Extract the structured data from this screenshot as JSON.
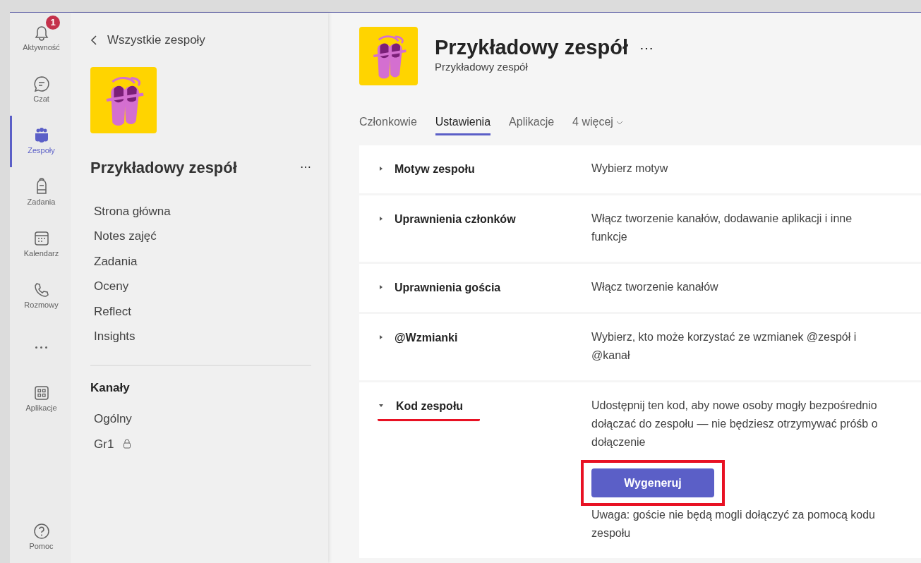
{
  "rail": [
    {
      "kind": "bell",
      "label": "Aktywność",
      "badge": "1",
      "selected": false
    },
    {
      "kind": "chat",
      "label": "Czat",
      "selected": false
    },
    {
      "kind": "teams",
      "label": "Zespoły",
      "selected": true
    },
    {
      "kind": "backpack",
      "label": "Zadania",
      "selected": false
    },
    {
      "kind": "calendar",
      "label": "Kalendarz",
      "selected": false
    },
    {
      "kind": "phone",
      "label": "Rozmowy",
      "selected": false
    },
    {
      "kind": "more",
      "selected": false
    },
    {
      "kind": "apps",
      "label": "Aplikacje",
      "selected": false
    }
  ],
  "rail_bottom": {
    "kind": "help",
    "label": "Pomoc"
  },
  "team_panel": {
    "back": "Wszystkie zespoły",
    "team_name": "Przykładowy zespół",
    "more": "⋯",
    "nav": [
      "Strona główna",
      "Notes zajęć",
      "Zadania",
      "Oceny",
      "Reflect",
      "Insights"
    ],
    "channels_heading": "Kanały",
    "channels": [
      {
        "name": "Ogólny",
        "private": false
      },
      {
        "name": "Gr1",
        "private": true
      }
    ]
  },
  "header": {
    "title": "Przykładowy zespół",
    "more": "⋯",
    "subtitle": "Przykładowy zespół"
  },
  "tabs": [
    {
      "label": "Członkowie",
      "selected": false
    },
    {
      "label": "Ustawienia",
      "selected": true
    },
    {
      "label": "Aplikacje",
      "selected": false
    },
    {
      "label": "4 więcej",
      "selected": false,
      "dropdown": true
    }
  ],
  "settings": [
    {
      "title": "Motyw zespołu",
      "description": "Wybierz motyw",
      "expanded": false,
      "underlined": false
    },
    {
      "title": "Uprawnienia członków",
      "description": "Włącz tworzenie kanałów, dodawanie aplikacji i inne funkcje",
      "expanded": false,
      "underlined": false
    },
    {
      "title": "Uprawnienia gościa",
      "description": "Włącz tworzenie kanałów",
      "expanded": false,
      "underlined": false
    },
    {
      "title": "@Wzmianki",
      "description": "Wybierz, kto może korzystać ze wzmianek @zespół i @kanał",
      "expanded": false,
      "underlined": false
    },
    {
      "title": "Kod zespołu",
      "description": "Udostępnij ten kod, aby nowe osoby mogły bezpośrednio dołączać do zespołu — nie będziesz otrzymywać próśb o dołączenie",
      "expanded": true,
      "underlined": true,
      "button": {
        "label": "Wygeneruj",
        "highlighted": true
      },
      "note": "Uwaga: goście nie będą mogli dołączyć za pomocą kodu zespołu"
    }
  ]
}
